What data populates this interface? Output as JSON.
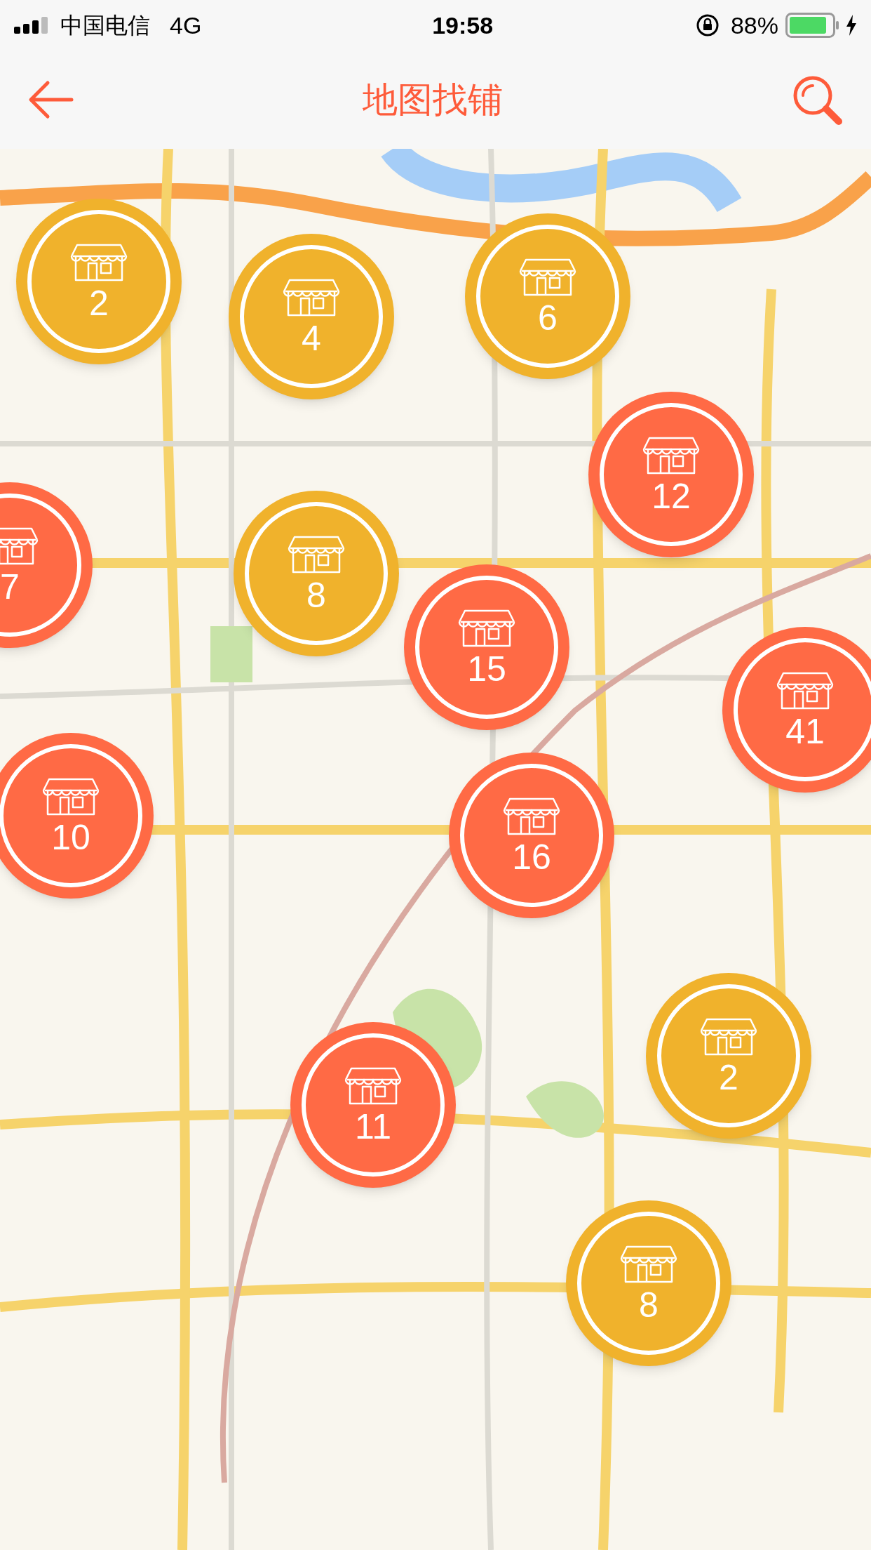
{
  "status_bar": {
    "carrier": "中国电信",
    "network": "4G",
    "time": "19:58",
    "battery": "88%"
  },
  "nav_bar": {
    "title": "地图找铺"
  },
  "map": {
    "clusters": [
      {
        "count": "2",
        "color": "#f0b22c"
      },
      {
        "count": "4",
        "color": "#f0b22c"
      },
      {
        "count": "6",
        "color": "#f0b22c"
      },
      {
        "count": "12",
        "color": "#ff6a45"
      },
      {
        "count": "7",
        "color": "#ff6a45"
      },
      {
        "count": "8",
        "color": "#f0b22c"
      },
      {
        "count": "15",
        "color": "#ff6a45"
      },
      {
        "count": "41",
        "color": "#ff6a45"
      },
      {
        "count": "10",
        "color": "#ff6a45"
      },
      {
        "count": "16",
        "color": "#ff6a45"
      },
      {
        "count": "2",
        "color": "#f0b22c"
      },
      {
        "count": "11",
        "color": "#ff6a45"
      },
      {
        "count": "8",
        "color": "#f0b22c"
      }
    ]
  }
}
